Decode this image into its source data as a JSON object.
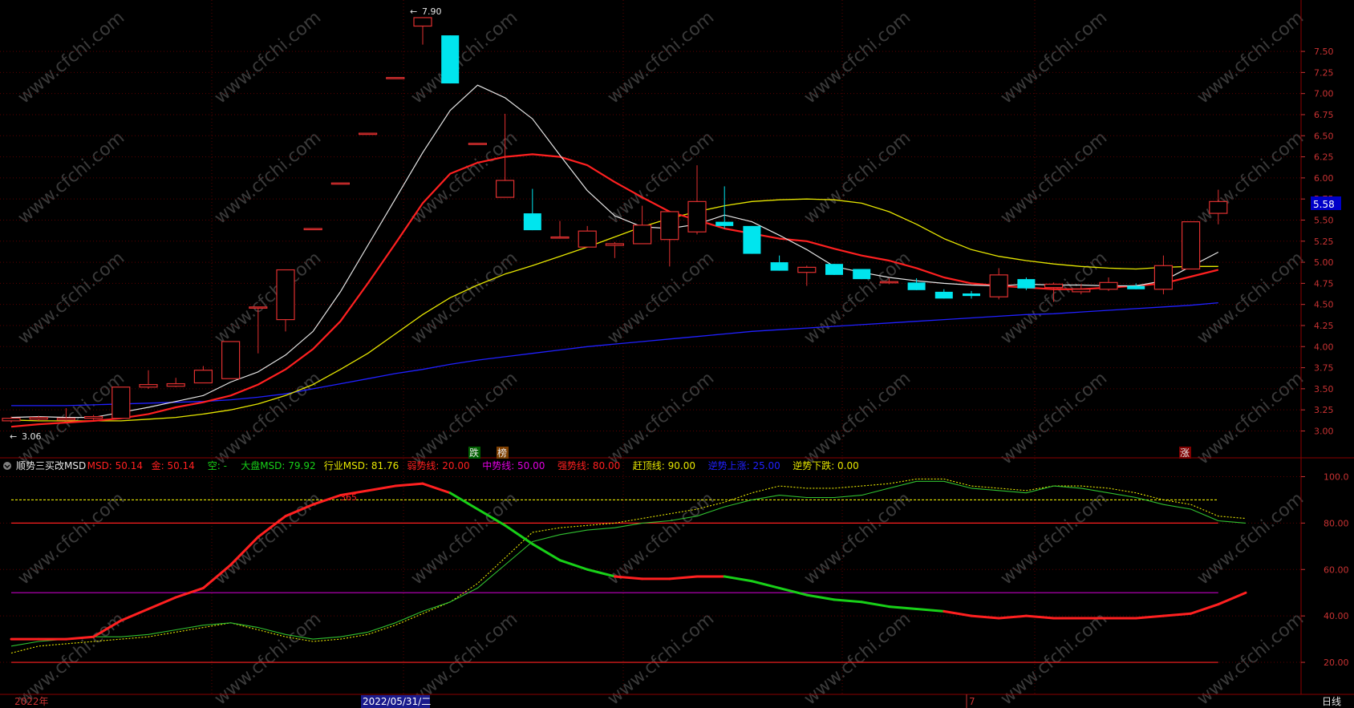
{
  "colors": {
    "background": "#000000",
    "grid": "#5a0000",
    "axis_text": "#c83232",
    "up_candle": "#e03030",
    "down_candle": "#00e5ee",
    "ma5": "#e6e6e6",
    "ma10": "#ff2020",
    "ma20": "#e6e600",
    "ma60": "#2020ff",
    "msd_green": "#18d018",
    "msd_red": "#ff2020",
    "msd_thin": "#30c030",
    "msd_dotted": "#e6e600",
    "line_80": "#ff2020",
    "line_20": "#ff2020",
    "line_50": "#c000c0",
    "line_90": "#e6e600"
  },
  "price_panel": {
    "last_price_tag": "5.58",
    "high_marker": "7.90",
    "low_marker": "3.06",
    "signal_labels": [
      "跌",
      "榜",
      "涨"
    ],
    "chart_data": {
      "type": "candlestick",
      "ylim": [
        2.9,
        7.9
      ],
      "y_ticks": [
        "7.50",
        "7.25",
        "7.00",
        "6.75",
        "6.50",
        "6.25",
        "6.00",
        "5.75",
        "5.50",
        "5.25",
        "5.00",
        "4.75",
        "4.50",
        "4.25",
        "4.00",
        "3.75",
        "3.50",
        "3.25",
        "3.00"
      ],
      "candles": [
        {
          "o": 3.12,
          "h": 3.17,
          "l": 3.1,
          "c": 3.15
        },
        {
          "o": 3.14,
          "h": 3.18,
          "l": 3.12,
          "c": 3.16
        },
        {
          "o": 3.13,
          "h": 3.27,
          "l": 3.12,
          "c": 3.15
        },
        {
          "o": 3.15,
          "h": 3.19,
          "l": 3.13,
          "c": 3.17
        },
        {
          "o": 3.15,
          "h": 3.52,
          "l": 3.15,
          "c": 3.52
        },
        {
          "o": 3.52,
          "h": 3.72,
          "l": 3.5,
          "c": 3.55
        },
        {
          "o": 3.53,
          "h": 3.63,
          "l": 3.52,
          "c": 3.56
        },
        {
          "o": 3.57,
          "h": 3.77,
          "l": 3.57,
          "c": 3.72
        },
        {
          "o": 3.62,
          "h": 4.06,
          "l": 3.62,
          "c": 4.06
        },
        {
          "o": 4.47,
          "h": 4.47,
          "l": 3.92,
          "c": 4.47
        },
        {
          "o": 4.32,
          "h": 4.91,
          "l": 4.18,
          "c": 4.91
        },
        {
          "o": 5.4,
          "h": 5.4,
          "l": 5.4,
          "c": 5.4
        },
        {
          "o": 5.94,
          "h": 5.94,
          "l": 5.94,
          "c": 5.94
        },
        {
          "o": 6.53,
          "h": 6.53,
          "l": 6.53,
          "c": 6.53
        },
        {
          "o": 7.19,
          "h": 7.19,
          "l": 7.19,
          "c": 7.19
        },
        {
          "o": 7.8,
          "h": 7.9,
          "l": 7.58,
          "c": 7.9
        },
        {
          "o": 7.69,
          "h": 7.69,
          "l": 7.12,
          "c": 7.12
        },
        {
          "o": 6.41,
          "h": 6.41,
          "l": 6.41,
          "c": 6.41
        },
        {
          "o": 5.77,
          "h": 6.76,
          "l": 5.77,
          "c": 5.97
        },
        {
          "o": 5.58,
          "h": 5.87,
          "l": 5.38,
          "c": 5.38
        },
        {
          "o": 5.3,
          "h": 5.49,
          "l": 5.28,
          "c": 5.3
        },
        {
          "o": 5.18,
          "h": 5.43,
          "l": 5.18,
          "c": 5.37
        },
        {
          "o": 5.2,
          "h": 5.24,
          "l": 5.05,
          "c": 5.22
        },
        {
          "o": 5.22,
          "h": 5.67,
          "l": 5.22,
          "c": 5.44
        },
        {
          "o": 5.27,
          "h": 5.6,
          "l": 4.95,
          "c": 5.6
        },
        {
          "o": 5.36,
          "h": 6.15,
          "l": 5.33,
          "c": 5.72
        },
        {
          "o": 5.48,
          "h": 5.9,
          "l": 5.4,
          "c": 5.43
        },
        {
          "o": 5.43,
          "h": 5.43,
          "l": 5.1,
          "c": 5.1
        },
        {
          "o": 5.0,
          "h": 5.08,
          "l": 4.9,
          "c": 4.9
        },
        {
          "o": 4.88,
          "h": 4.96,
          "l": 4.72,
          "c": 4.94
        },
        {
          "o": 4.98,
          "h": 4.98,
          "l": 4.85,
          "c": 4.85
        },
        {
          "o": 4.92,
          "h": 4.92,
          "l": 4.8,
          "c": 4.8
        },
        {
          "o": 4.76,
          "h": 4.81,
          "l": 4.74,
          "c": 4.77
        },
        {
          "o": 4.76,
          "h": 4.81,
          "l": 4.67,
          "c": 4.67
        },
        {
          "o": 4.65,
          "h": 4.68,
          "l": 4.57,
          "c": 4.57
        },
        {
          "o": 4.63,
          "h": 4.66,
          "l": 4.57,
          "c": 4.6
        },
        {
          "o": 4.59,
          "h": 4.93,
          "l": 4.56,
          "c": 4.85
        },
        {
          "o": 4.8,
          "h": 4.82,
          "l": 4.67,
          "c": 4.69
        },
        {
          "o": 4.7,
          "h": 4.76,
          "l": 4.53,
          "c": 4.74
        },
        {
          "o": 4.65,
          "h": 4.74,
          "l": 4.62,
          "c": 4.68
        },
        {
          "o": 4.68,
          "h": 4.82,
          "l": 4.66,
          "c": 4.76
        },
        {
          "o": 4.72,
          "h": 4.75,
          "l": 4.68,
          "c": 4.68
        },
        {
          "o": 4.68,
          "h": 5.08,
          "l": 4.62,
          "c": 4.96
        },
        {
          "o": 4.92,
          "h": 5.48,
          "l": 4.92,
          "c": 5.48
        },
        {
          "o": 5.58,
          "h": 5.86,
          "l": 5.45,
          "c": 5.72
        }
      ],
      "ma5": [
        3.16,
        3.17,
        3.16,
        3.16,
        3.22,
        3.28,
        3.35,
        3.42,
        3.58,
        3.7,
        3.9,
        4.18,
        4.65,
        5.2,
        5.75,
        6.3,
        6.8,
        7.1,
        6.95,
        6.7,
        6.27,
        5.85,
        5.55,
        5.42,
        5.4,
        5.45,
        5.56,
        5.48,
        5.32,
        5.15,
        4.95,
        4.88,
        4.82,
        4.78,
        4.75,
        4.73,
        4.72,
        4.74,
        4.73,
        4.73,
        4.72,
        4.72,
        4.78,
        4.95,
        5.12
      ],
      "ma10": [
        3.05,
        3.08,
        3.1,
        3.12,
        3.15,
        3.2,
        3.28,
        3.34,
        3.42,
        3.55,
        3.73,
        3.97,
        4.3,
        4.75,
        5.22,
        5.7,
        6.05,
        6.18,
        6.25,
        6.28,
        6.25,
        6.15,
        5.95,
        5.77,
        5.6,
        5.5,
        5.4,
        5.34,
        5.28,
        5.25,
        5.16,
        5.08,
        5.02,
        4.93,
        4.82,
        4.75,
        4.72,
        4.7,
        4.68,
        4.68,
        4.7,
        4.72,
        4.75,
        4.83,
        4.91
      ],
      "ma20": [
        3.13,
        3.12,
        3.12,
        3.12,
        3.12,
        3.14,
        3.16,
        3.2,
        3.25,
        3.32,
        3.42,
        3.55,
        3.73,
        3.92,
        4.15,
        4.38,
        4.58,
        4.73,
        4.86,
        4.96,
        5.07,
        5.18,
        5.3,
        5.42,
        5.52,
        5.6,
        5.67,
        5.72,
        5.74,
        5.75,
        5.74,
        5.7,
        5.6,
        5.45,
        5.28,
        5.15,
        5.07,
        5.02,
        4.98,
        4.95,
        4.93,
        4.92,
        4.94,
        4.95,
        4.95
      ],
      "ma60": [
        3.3,
        3.3,
        3.3,
        3.31,
        3.32,
        3.33,
        3.34,
        3.35,
        3.37,
        3.4,
        3.44,
        3.5,
        3.56,
        3.62,
        3.68,
        3.73,
        3.79,
        3.84,
        3.88,
        3.92,
        3.96,
        4.0,
        4.03,
        4.06,
        4.09,
        4.12,
        4.15,
        4.18,
        4.2,
        4.22,
        4.24,
        4.26,
        4.28,
        4.3,
        4.32,
        4.34,
        4.36,
        4.38,
        4.39,
        4.41,
        4.43,
        4.45,
        4.47,
        4.49,
        4.52
      ]
    }
  },
  "indicator_panel": {
    "legend": [
      {
        "text": "顺势三买改MSD",
        "color": "#e6e6e6"
      },
      {
        "text": "MSD: 50.14",
        "color": "#ff2020"
      },
      {
        "text": "金: 50.14",
        "color": "#ff2020"
      },
      {
        "text": "空: -",
        "color": "#18d018"
      },
      {
        "text": "大盘MSD: 79.92",
        "color": "#18d018"
      },
      {
        "text": "行业MSD: 81.76",
        "color": "#e6e600"
      },
      {
        "text": "弱势线: 20.00",
        "color": "#ff2020"
      },
      {
        "text": "中势线: 50.00",
        "color": "#e000e0"
      },
      {
        "text": "强势线: 80.00",
        "color": "#ff2020"
      },
      {
        "text": "赶顶线: 90.00",
        "color": "#e6e600"
      },
      {
        "text": "逆势上涨: 25.00",
        "color": "#2020ff"
      },
      {
        "text": "逆势下跌: 0.00",
        "color": "#e6e600"
      }
    ],
    "mini_label": "365",
    "chart_data": {
      "type": "line",
      "ylim": [
        10,
        105
      ],
      "y_ticks": [
        "100.0",
        "80.00",
        "60.00",
        "40.00",
        "20.00"
      ],
      "ref_lines": {
        "weak": 20,
        "mid": 50,
        "strong": 80,
        "top": 90
      },
      "msd": [
        30,
        30,
        30,
        31,
        38,
        43,
        48,
        52,
        62,
        74,
        83,
        88,
        92,
        94,
        96,
        97,
        93,
        86,
        79,
        71,
        64,
        60,
        57,
        56,
        56,
        57,
        57,
        55,
        52,
        49,
        47,
        46,
        44,
        43,
        42,
        40,
        39,
        40,
        39,
        39,
        39,
        39,
        40,
        41,
        45,
        50
      ],
      "msd_down_segments": [
        [
          16,
          22
        ],
        [
          26,
          34
        ],
        [
          44,
          44
        ]
      ],
      "dapan_msd": [
        27,
        29,
        30,
        31,
        31,
        32,
        34,
        36,
        37,
        35,
        32,
        30,
        31,
        33,
        37,
        42,
        46,
        52,
        62,
        72,
        75,
        77,
        78,
        80,
        81,
        83,
        87,
        90,
        92,
        91,
        91,
        92,
        95,
        98,
        98,
        95,
        94,
        93,
        96,
        95,
        93,
        91,
        88,
        86,
        81,
        80
      ],
      "hangye_msd": [
        24,
        27,
        28,
        29,
        30,
        31,
        33,
        35,
        37,
        34,
        31,
        29,
        30,
        32,
        36,
        41,
        46,
        54,
        65,
        76,
        78,
        79,
        80,
        82,
        84,
        86,
        89,
        93,
        96,
        95,
        95,
        96,
        97,
        99,
        99,
        96,
        95,
        94,
        96,
        96,
        95,
        93,
        90,
        88,
        83,
        82
      ]
    }
  },
  "bottom_axis": {
    "left_label": "2022年",
    "date_highlight": "2022/05/31/二",
    "month_mark": "7",
    "right_label": "日线"
  },
  "watermark": "www.cfchi.com"
}
